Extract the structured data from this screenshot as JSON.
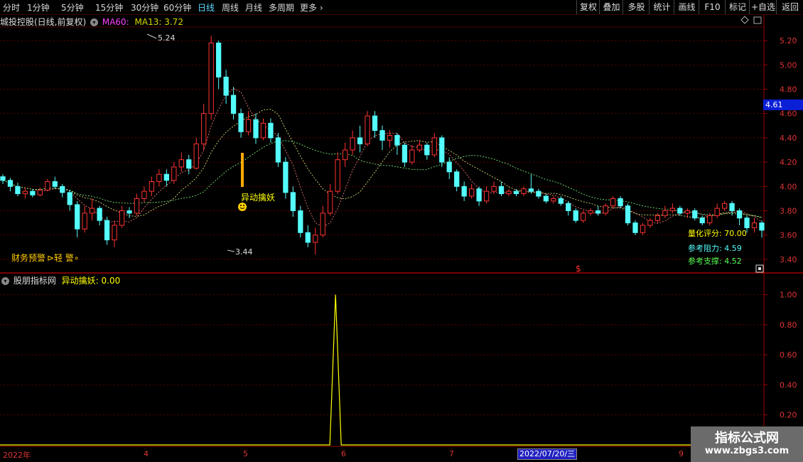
{
  "toolbar": {
    "periods": [
      "分时",
      "1分钟",
      "5分钟",
      "15分钟",
      "30分钟",
      "60分钟",
      "日线",
      "周线",
      "月线",
      "多周期",
      "更多 ›"
    ],
    "active_period": "日线",
    "right_buttons": [
      "复权",
      "叠加",
      "多股",
      "统计",
      "画线",
      "F10",
      "标记",
      "+自选",
      "返回"
    ]
  },
  "main_title": {
    "stock": "城投控股(日线,前复权)",
    "ma60": "MA60:",
    "ma13": "MA13: 3.72"
  },
  "price_axis": [
    "5.20",
    "5.00",
    "4.80",
    "4.60",
    "4.40",
    "4.20",
    "4.00",
    "3.80",
    "3.60",
    "3.40"
  ],
  "current_price": "4.61",
  "annotations": {
    "high": "5.24",
    "low": "3.44",
    "signal": "异动擒妖",
    "warning_label": "财务预警",
    "warning_value": "轻 警",
    "dollar": "$"
  },
  "info": {
    "score_label": "量化评分:",
    "score_value": "70.00",
    "resistance_label": "参考阻力:",
    "resistance_value": "4.59",
    "support_label": "参考支撑:",
    "support_value": "4.52"
  },
  "sub_title": {
    "site": "股朋指标网",
    "indicator": "异动擒妖: 0.00"
  },
  "sub_axis": [
    "1.00",
    "0.80",
    "0.60",
    "0.40",
    "0.20"
  ],
  "x_axis": {
    "labels": [
      "2022年",
      "4",
      "5",
      "6",
      "7",
      "9"
    ],
    "date_tag": "2022/07/20/三"
  },
  "watermark": {
    "line1": "指标公式网",
    "line2": "www.zbgs3.com"
  },
  "colors": {
    "up": "#ff3232",
    "down": "#54fcfc",
    "ma": "#ffffff",
    "signal": "#ffff00",
    "grid": "#800000"
  },
  "chart_data": {
    "type": "candlestick",
    "ylim": [
      3.3,
      5.3
    ],
    "candles": [
      [
        4.08,
        4.05,
        4.1,
        4.02
      ],
      [
        4.05,
        4.0,
        4.07,
        3.96
      ],
      [
        4.0,
        3.94,
        4.03,
        3.92
      ],
      [
        3.94,
        3.96,
        3.99,
        3.9
      ],
      [
        3.96,
        3.93,
        3.98,
        3.91
      ],
      [
        3.93,
        3.97,
        3.99,
        3.92
      ],
      [
        3.97,
        4.04,
        4.06,
        3.96
      ],
      [
        4.04,
        4.0,
        4.08,
        3.98
      ],
      [
        4.0,
        3.95,
        4.02,
        3.91
      ],
      [
        3.95,
        3.85,
        3.97,
        3.8
      ],
      [
        3.85,
        3.65,
        3.88,
        3.58
      ],
      [
        3.65,
        3.78,
        3.84,
        3.62
      ],
      [
        3.78,
        3.82,
        3.9,
        3.72
      ],
      [
        3.82,
        3.72,
        3.84,
        3.68
      ],
      [
        3.72,
        3.56,
        3.75,
        3.52
      ],
      [
        3.56,
        3.68,
        3.72,
        3.5
      ],
      [
        3.68,
        3.8,
        3.84,
        3.66
      ],
      [
        3.8,
        3.78,
        3.83,
        3.74
      ],
      [
        3.78,
        3.9,
        3.94,
        3.76
      ],
      [
        3.9,
        3.96,
        4.0,
        3.87
      ],
      [
        3.96,
        4.04,
        4.08,
        3.92
      ],
      [
        4.04,
        4.1,
        4.14,
        4.0
      ],
      [
        4.1,
        4.05,
        4.14,
        4.0
      ],
      [
        4.05,
        4.16,
        4.2,
        4.02
      ],
      [
        4.16,
        4.22,
        4.28,
        4.12
      ],
      [
        4.22,
        4.15,
        4.26,
        4.1
      ],
      [
        4.15,
        4.35,
        4.4,
        4.14
      ],
      [
        4.35,
        4.6,
        4.68,
        4.3
      ],
      [
        4.6,
        5.18,
        5.24,
        4.55
      ],
      [
        5.18,
        4.9,
        5.2,
        4.8
      ],
      [
        4.9,
        4.75,
        4.96,
        4.68
      ],
      [
        4.75,
        4.6,
        4.82,
        4.55
      ],
      [
        4.6,
        4.45,
        4.64,
        4.4
      ],
      [
        4.45,
        4.55,
        4.62,
        4.42
      ],
      [
        4.55,
        4.4,
        4.6,
        4.35
      ],
      [
        4.4,
        4.52,
        4.56,
        4.38
      ],
      [
        4.52,
        4.4,
        4.56,
        4.36
      ],
      [
        4.4,
        4.2,
        4.44,
        4.16
      ],
      [
        4.2,
        3.95,
        4.24,
        3.9
      ],
      [
        3.95,
        3.8,
        4.0,
        3.75
      ],
      [
        3.8,
        3.62,
        3.84,
        3.58
      ],
      [
        3.62,
        3.54,
        3.68,
        3.5
      ],
      [
        3.54,
        3.6,
        3.66,
        3.44
      ],
      [
        3.6,
        3.78,
        3.84,
        3.58
      ],
      [
        3.78,
        3.96,
        4.02,
        3.76
      ],
      [
        3.96,
        4.22,
        4.28,
        3.94
      ],
      [
        4.22,
        4.3,
        4.36,
        4.16
      ],
      [
        4.3,
        4.4,
        4.46,
        4.26
      ],
      [
        4.4,
        4.35,
        4.5,
        4.28
      ],
      [
        4.35,
        4.58,
        4.62,
        4.33
      ],
      [
        4.58,
        4.46,
        4.62,
        4.4
      ],
      [
        4.46,
        4.38,
        4.5,
        4.3
      ],
      [
        4.38,
        4.42,
        4.46,
        4.32
      ],
      [
        4.42,
        4.34,
        4.44,
        4.26
      ],
      [
        4.34,
        4.2,
        4.36,
        4.16
      ],
      [
        4.2,
        4.3,
        4.34,
        4.18
      ],
      [
        4.3,
        4.34,
        4.38,
        4.28
      ],
      [
        4.34,
        4.26,
        4.36,
        4.22
      ],
      [
        4.26,
        4.4,
        4.44,
        4.24
      ],
      [
        4.4,
        4.2,
        4.42,
        4.16
      ],
      [
        4.2,
        4.12,
        4.24,
        4.06
      ],
      [
        4.12,
        4.0,
        4.14,
        3.96
      ],
      [
        4.0,
        3.92,
        4.04,
        3.88
      ],
      [
        3.92,
        3.98,
        4.02,
        3.9
      ],
      [
        3.98,
        3.88,
        4.0,
        3.84
      ],
      [
        3.88,
        3.96,
        4.0,
        3.86
      ],
      [
        3.96,
        4.0,
        4.04,
        3.94
      ],
      [
        4.0,
        3.94,
        4.04,
        3.92
      ],
      [
        3.94,
        3.96,
        3.98,
        3.92
      ],
      [
        3.96,
        3.94,
        3.98,
        3.92
      ],
      [
        3.94,
        3.98,
        4.0,
        3.92
      ],
      [
        3.98,
        3.96,
        4.1,
        3.94
      ],
      [
        3.96,
        3.92,
        3.98,
        3.9
      ],
      [
        3.92,
        3.88,
        3.94,
        3.86
      ],
      [
        3.88,
        3.9,
        3.92,
        3.86
      ],
      [
        3.9,
        3.86,
        3.92,
        3.84
      ],
      [
        3.86,
        3.8,
        3.88,
        3.76
      ],
      [
        3.8,
        3.72,
        3.82,
        3.7
      ],
      [
        3.72,
        3.78,
        3.8,
        3.7
      ],
      [
        3.78,
        3.8,
        3.82,
        3.76
      ],
      [
        3.8,
        3.78,
        3.84,
        3.76
      ],
      [
        3.78,
        3.84,
        3.86,
        3.76
      ],
      [
        3.84,
        3.9,
        3.92,
        3.82
      ],
      [
        3.9,
        3.84,
        3.92,
        3.82
      ],
      [
        3.84,
        3.7,
        3.86,
        3.68
      ],
      [
        3.7,
        3.62,
        3.72,
        3.6
      ],
      [
        3.62,
        3.68,
        3.7,
        3.6
      ],
      [
        3.68,
        3.72,
        3.74,
        3.66
      ],
      [
        3.72,
        3.76,
        3.78,
        3.7
      ],
      [
        3.76,
        3.8,
        3.84,
        3.74
      ],
      [
        3.8,
        3.82,
        3.86,
        3.78
      ],
      [
        3.82,
        3.78,
        3.84,
        3.76
      ],
      [
        3.78,
        3.8,
        3.82,
        3.74
      ],
      [
        3.8,
        3.74,
        3.82,
        3.72
      ],
      [
        3.74,
        3.7,
        3.76,
        3.68
      ],
      [
        3.7,
        3.76,
        3.78,
        3.68
      ],
      [
        3.76,
        3.82,
        3.86,
        3.74
      ],
      [
        3.82,
        3.86,
        3.88,
        3.8
      ],
      [
        3.86,
        3.8,
        3.88,
        3.76
      ],
      [
        3.8,
        3.74,
        3.82,
        3.68
      ],
      [
        3.74,
        3.66,
        3.76,
        3.62
      ],
      [
        3.66,
        3.7,
        3.74,
        3.62
      ],
      [
        3.7,
        3.64,
        3.72,
        3.58
      ]
    ],
    "signal": [
      {
        "index": 45,
        "value": 1.0
      }
    ],
    "sub_ylim": [
      0,
      1.05
    ]
  }
}
